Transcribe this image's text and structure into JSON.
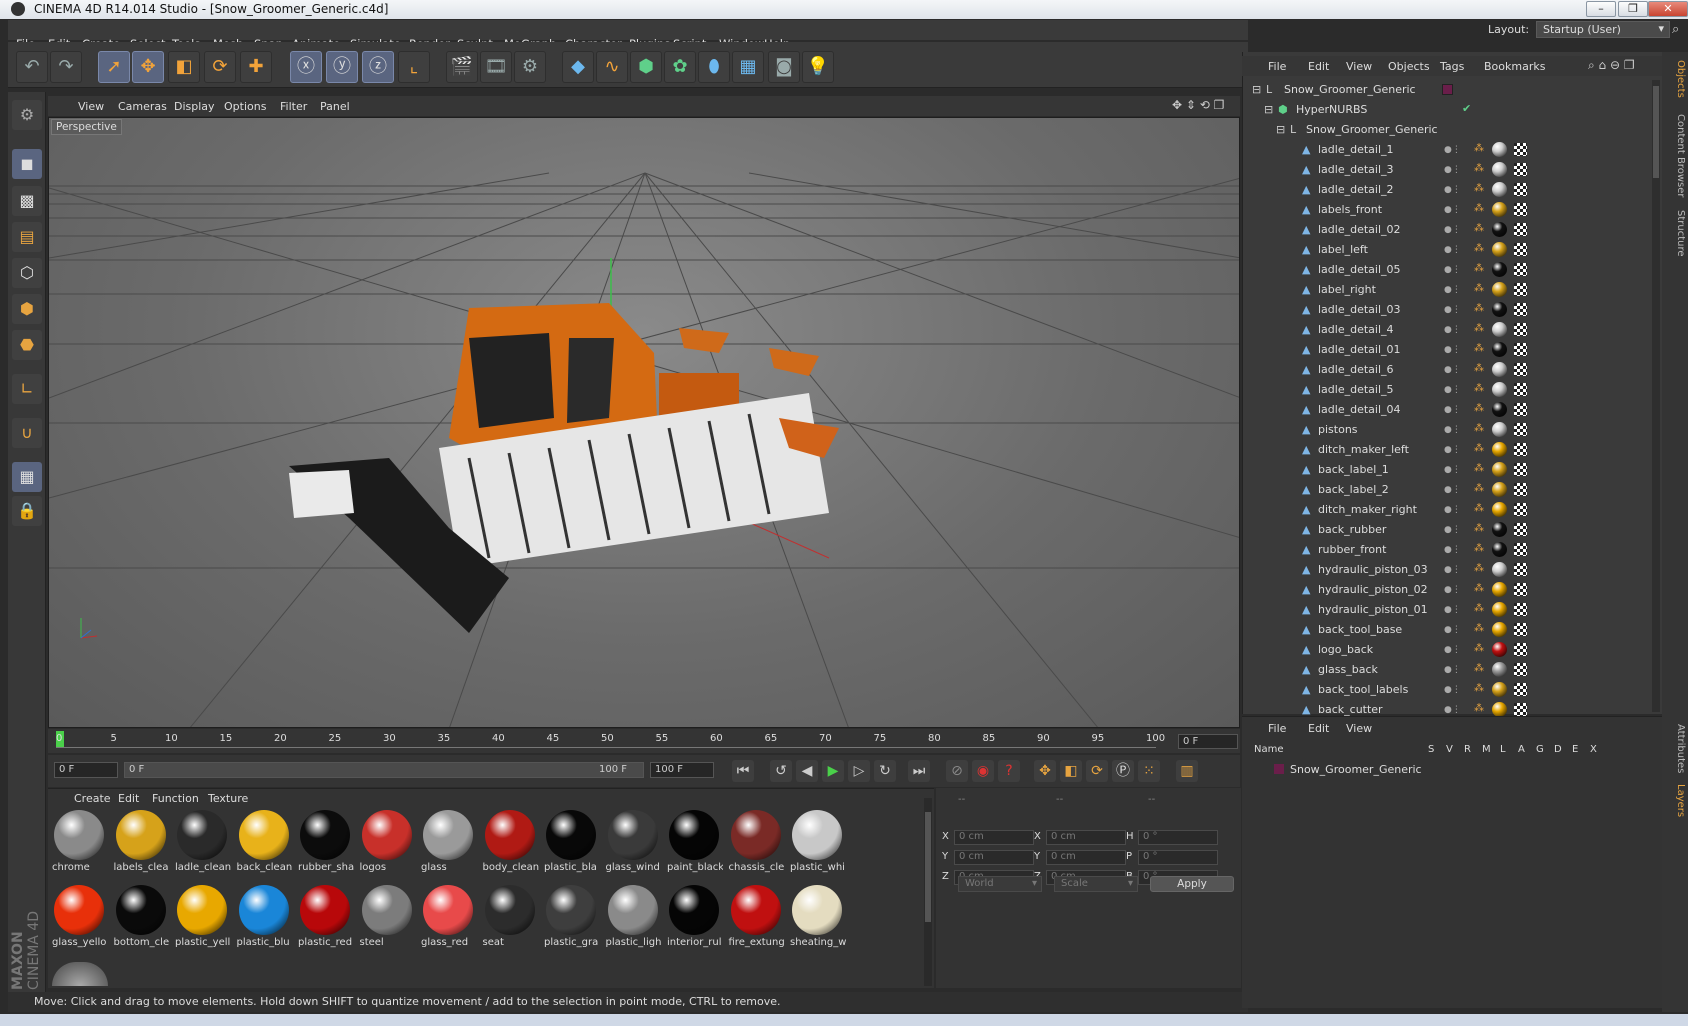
{
  "window": {
    "title": "CINEMA 4D R14.014 Studio - [Snow_Groomer_Generic.c4d]"
  },
  "menubar": [
    "File",
    "Edit",
    "Create",
    "Select",
    "Tools",
    "Mesh",
    "Snap",
    "Animate",
    "Simulate",
    "Render",
    "Sculpt",
    "MoGraph",
    "Character",
    "Plugins",
    "Script",
    "Window",
    "Help"
  ],
  "layout": {
    "label": "Layout:",
    "value": "Startup (User)"
  },
  "viewport": {
    "menu": [
      "View",
      "Cameras",
      "Display",
      "Options",
      "Filter",
      "Panel"
    ],
    "label": "Perspective"
  },
  "timeline": {
    "ticks": [
      "0",
      "5",
      "10",
      "15",
      "20",
      "25",
      "30",
      "35",
      "40",
      "45",
      "50",
      "55",
      "60",
      "65",
      "70",
      "75",
      "80",
      "85",
      "90",
      "95",
      "100"
    ],
    "current_frame": "0 F",
    "start_field": "0 F",
    "range_start": "0 F",
    "range_end": "100 F",
    "end_field": "100 F"
  },
  "materials": {
    "menu": [
      "Create",
      "Edit",
      "Function",
      "Texture"
    ],
    "items": [
      {
        "label": "chrome",
        "color": "#8a8a8a"
      },
      {
        "label": "labels_clea",
        "color": "#d6a21a"
      },
      {
        "label": "ladle_clean",
        "color": "#2a2a2a"
      },
      {
        "label": "back_clean",
        "color": "#e8b21a"
      },
      {
        "label": "rubber_sha",
        "color": "#0c0c0c"
      },
      {
        "label": "logos",
        "color": "#c8302a"
      },
      {
        "label": "glass",
        "color": "#9a9a9a"
      },
      {
        "label": "body_clean",
        "color": "#b01a14"
      },
      {
        "label": "plastic_bla",
        "color": "#080808"
      },
      {
        "label": "glass_wind",
        "color": "#3a3a3a"
      },
      {
        "label": "paint_black",
        "color": "#050505"
      },
      {
        "label": "chassis_cle",
        "color": "#7a2a26"
      },
      {
        "label": "plastic_whi",
        "color": "#c8c8c8"
      },
      {
        "label": "glass_yello",
        "color": "#e8300a"
      },
      {
        "label": "bottom_cle",
        "color": "#0a0a0a"
      },
      {
        "label": "plastic_yell",
        "color": "#e8a800"
      },
      {
        "label": "plastic_blu",
        "color": "#1a86d8"
      },
      {
        "label": "plastic_red",
        "color": "#b8080a"
      },
      {
        "label": "steel",
        "color": "#7c7c7c"
      },
      {
        "label": "glass_red",
        "color": "#e84a4a"
      },
      {
        "label": "seat",
        "color": "#2c2c2c"
      },
      {
        "label": "plastic_gra",
        "color": "#3e3e3e"
      },
      {
        "label": "plastic_ligh",
        "color": "#8a8a8a"
      },
      {
        "label": "interior_rul",
        "color": "#050505"
      },
      {
        "label": "fire_extung",
        "color": "#c01010"
      },
      {
        "label": "sheating_w",
        "color": "#e4dcc0"
      }
    ]
  },
  "coords": {
    "headers": [
      "--",
      "--",
      "--"
    ],
    "rows": [
      {
        "a": "X",
        "av": "0 cm",
        "b": "X",
        "bv": "0 cm",
        "c": "H",
        "cv": "0 °"
      },
      {
        "a": "Y",
        "av": "0 cm",
        "b": "Y",
        "bv": "0 cm",
        "c": "P",
        "cv": "0 °"
      },
      {
        "a": "Z",
        "av": "0 cm",
        "b": "Z",
        "bv": "0 cm",
        "c": "B",
        "cv": "0 °"
      }
    ],
    "world": "World",
    "scale": "Scale",
    "apply": "Apply"
  },
  "objects": {
    "menu": [
      "File",
      "Edit",
      "View",
      "Objects",
      "Tags",
      "Bookmarks"
    ],
    "root": "Snow_Groomer_Generic",
    "hypernurbs": "HyperNURBS",
    "group": "Snow_Groomer_Generic",
    "items": [
      {
        "name": "ladle_detail_1",
        "tag": "#cfcfcf"
      },
      {
        "name": "ladle_detail_3",
        "tag": "#cfcfcf"
      },
      {
        "name": "ladle_detail_2",
        "tag": "#cfcfcf"
      },
      {
        "name": "labels_front",
        "tag": "#d6a21a"
      },
      {
        "name": "ladle_detail_02",
        "tag": "#111"
      },
      {
        "name": "label_left",
        "tag": "#d6a21a"
      },
      {
        "name": "ladle_detail_05",
        "tag": "#111"
      },
      {
        "name": "label_right",
        "tag": "#d6a21a"
      },
      {
        "name": "ladle_detail_03",
        "tag": "#111"
      },
      {
        "name": "ladle_detail_4",
        "tag": "#cfcfcf"
      },
      {
        "name": "ladle_detail_01",
        "tag": "#111"
      },
      {
        "name": "ladle_detail_6",
        "tag": "#cfcfcf"
      },
      {
        "name": "ladle_detail_5",
        "tag": "#cfcfcf"
      },
      {
        "name": "ladle_detail_04",
        "tag": "#111"
      },
      {
        "name": "pistons",
        "tag": "#cfcfcf"
      },
      {
        "name": "ditch_maker_left",
        "tag": "#e8a800"
      },
      {
        "name": "back_label_1",
        "tag": "#d6a21a"
      },
      {
        "name": "back_label_2",
        "tag": "#d6a21a"
      },
      {
        "name": "ditch_maker_right",
        "tag": "#e8a800"
      },
      {
        "name": "back_rubber",
        "tag": "#111"
      },
      {
        "name": "rubber_front",
        "tag": "#111"
      },
      {
        "name": "hydraulic_piston_03",
        "tag": "#cfcfcf"
      },
      {
        "name": "hydraulic_piston_02",
        "tag": "#e8a800"
      },
      {
        "name": "hydraulic_piston_01",
        "tag": "#e8a800"
      },
      {
        "name": "back_tool_base",
        "tag": "#e8a800"
      },
      {
        "name": "logo_back",
        "tag": "#c01010"
      },
      {
        "name": "glass_back",
        "tag": "#9a9a9a"
      },
      {
        "name": "back_tool_labels",
        "tag": "#d6a21a"
      },
      {
        "name": "back_cutter",
        "tag": "#e8a800"
      }
    ]
  },
  "layers": {
    "menu": [
      "File",
      "Edit",
      "View"
    ],
    "columns": [
      "Name",
      "S",
      "V",
      "R",
      "M",
      "L",
      "A",
      "G",
      "D",
      "E",
      "X"
    ],
    "row": "Snow_Groomer_Generic"
  },
  "sidetabs": [
    "Objects",
    "Content Browser",
    "Structure",
    "Attributes",
    "Layers"
  ],
  "status": "Move: Click and drag to move elements. Hold down SHIFT to quantize movement / add to the selection in point mode, CTRL to remove.",
  "brand": {
    "line1": "MAXON",
    "line2": "CINEMA 4D"
  }
}
